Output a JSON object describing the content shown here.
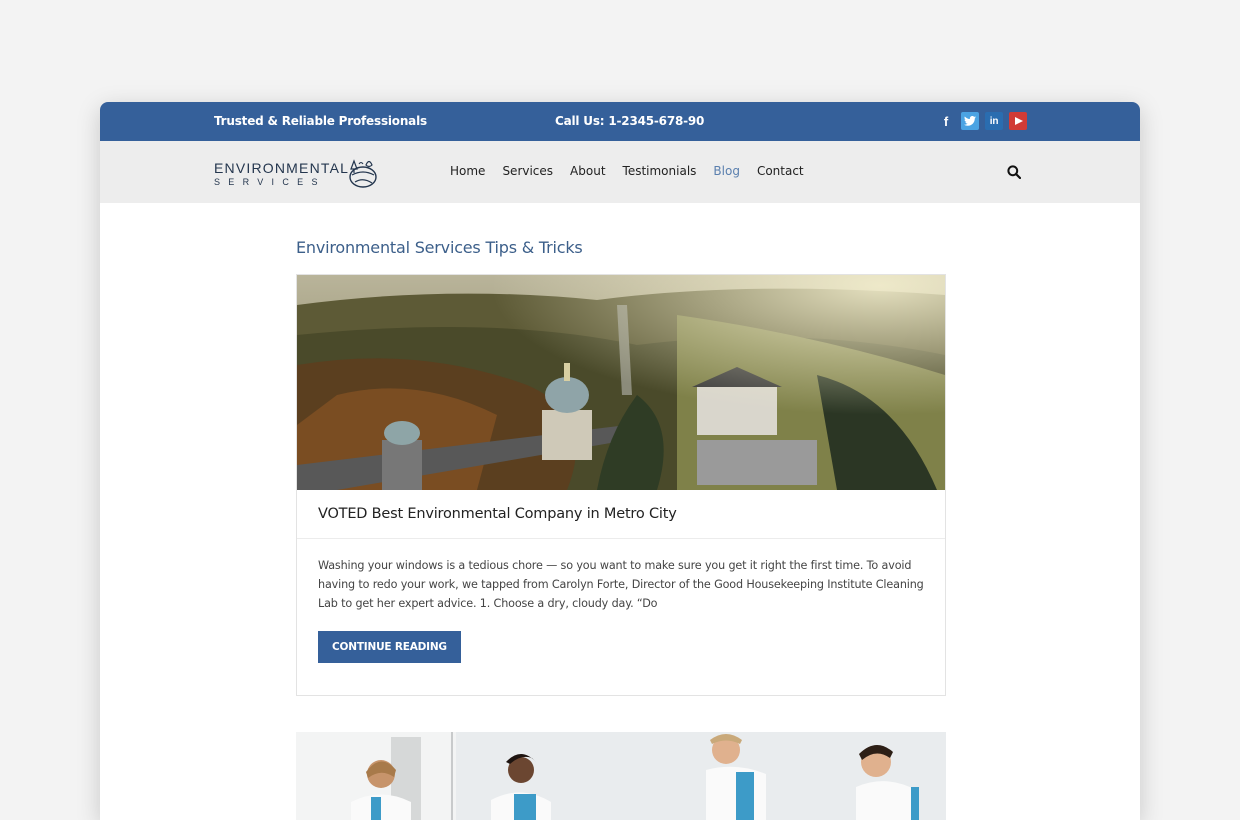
{
  "topbar": {
    "tagline": "Trusted & Reliable Professionals",
    "phone": "Call Us: 1-2345-678-90",
    "social": [
      {
        "name": "facebook-icon",
        "glyph": "f"
      },
      {
        "name": "twitter-icon",
        "glyph": "t"
      },
      {
        "name": "linkedin-icon",
        "glyph": "in"
      },
      {
        "name": "youtube-icon",
        "glyph": "▶"
      }
    ]
  },
  "logo": {
    "line1": "ENVIRONMENTAL",
    "line2": "SERVICES"
  },
  "nav": {
    "items": [
      "Home",
      "Services",
      "About",
      "Testimonials",
      "Blog",
      "Contact"
    ],
    "active": "Blog"
  },
  "page": {
    "heading": "Environmental Services Tips & Tricks"
  },
  "post": {
    "title": "VOTED Best Environmental Company in Metro City",
    "excerpt": "Washing your windows is a tedious chore — so you want to make sure you get it right the first time. To avoid having to redo your work, we tapped from Carolyn Forte, Director of the Good Housekeeping Institute Cleaning Lab to get her expert advice. 1. Choose a dry, cloudy day. “Do",
    "button": "CONTINUE READING"
  },
  "colors": {
    "brand": "#35609a",
    "accent_link": "#5a7fae"
  }
}
